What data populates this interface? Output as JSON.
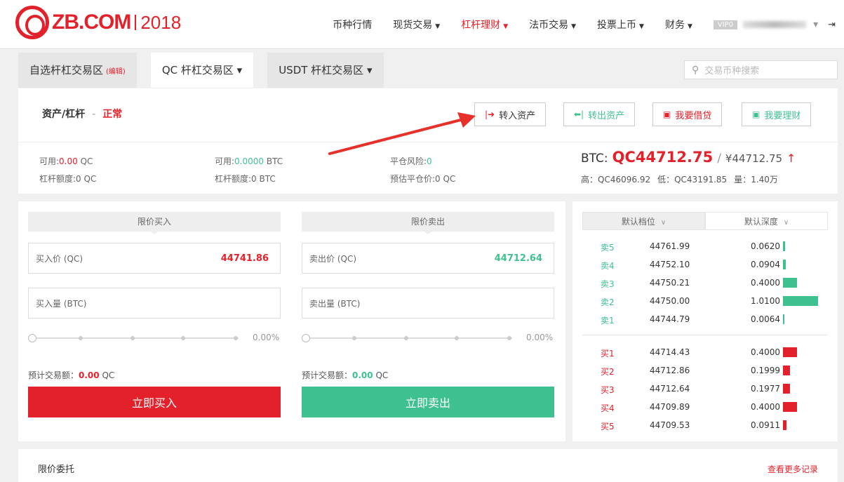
{
  "header": {
    "logo_text": "ZB.COM",
    "logo_year": "2018",
    "nav": [
      {
        "label": "币种行情",
        "caret": false,
        "active": false
      },
      {
        "label": "现货交易",
        "caret": true,
        "active": false
      },
      {
        "label": "杠杆理财",
        "caret": true,
        "active": true
      },
      {
        "label": "法币交易",
        "caret": true,
        "active": false
      },
      {
        "label": "投票上币",
        "caret": true,
        "active": false
      },
      {
        "label": "财务",
        "caret": true,
        "active": false
      }
    ],
    "vip_label": "VIP0",
    "account_caret": "▾",
    "exit_glyph": "⇥"
  },
  "tabs": [
    {
      "label": "自选杆杠交易区",
      "tag": "(编辑)",
      "active": false
    },
    {
      "label": "QC 杆杠交易区",
      "caret": "▾",
      "active": true
    },
    {
      "label": "USDT 杆杠交易区",
      "caret": "▾",
      "active": false
    }
  ],
  "search": {
    "placeholder": "交易币种搜索",
    "icon": "search-icon"
  },
  "assets": {
    "title": "资产/杠杆",
    "separator": "-",
    "status": "正常",
    "buttons": {
      "transfer_in": "转入资产",
      "transfer_out": "转出资产",
      "borrow": "我要借贷",
      "invest": "我要理财"
    },
    "qc_available_label": "可用:",
    "qc_available_value": "0.00",
    "qc_unit": "QC",
    "qc_limit": "杠杆额度:0 QC",
    "btc_available_label": "可用:",
    "btc_available_value": "0.0000",
    "btc_unit": "BTC",
    "btc_limit": "杠杆额度:0 BTC",
    "risk_label": "平仓风险:",
    "risk_value": "0",
    "liq_price": "预估平仓价:0 QC",
    "pair": "BTC:",
    "price_qc": "QC44712.75",
    "slash": "/",
    "price_cny": "¥44712.75",
    "up_arrow": "↑",
    "high": "高：QC46096.92",
    "low": "低：QC43191.85",
    "volume": "量：1.40万"
  },
  "buy": {
    "header": "限价买入",
    "price_label": "买入价 (QC)",
    "price_value": "44741.86",
    "amount_label": "买入量 (BTC)",
    "percent": "0.00%",
    "est_label": "预计交易额：",
    "est_value": "0.00",
    "est_unit": "QC",
    "button": "立即买入"
  },
  "sell": {
    "header": "限价卖出",
    "price_label": "卖出价 (QC)",
    "price_value": "44712.64",
    "amount_label": "卖出量 (BTC)",
    "percent": "0.00%",
    "est_label": "预计交易额：",
    "est_value": "0.00",
    "est_unit": "QC",
    "button": "立即卖出"
  },
  "orderbook": {
    "head_left": "默认档位",
    "head_right": "默认深度",
    "asks": [
      {
        "label": "卖5",
        "price": "44761.99",
        "amount": "0.0620",
        "depth": 0.062
      },
      {
        "label": "卖4",
        "price": "44752.10",
        "amount": "0.0904",
        "depth": 0.0904
      },
      {
        "label": "卖3",
        "price": "44750.21",
        "amount": "0.4000",
        "depth": 0.4
      },
      {
        "label": "卖2",
        "price": "44750.00",
        "amount": "1.0100",
        "depth": 1.01
      },
      {
        "label": "卖1",
        "price": "44744.79",
        "amount": "0.0064",
        "depth": 0.0064
      }
    ],
    "bids": [
      {
        "label": "买1",
        "price": "44714.43",
        "amount": "0.4000",
        "depth": 0.4
      },
      {
        "label": "买2",
        "price": "44712.86",
        "amount": "0.1999",
        "depth": 0.1999
      },
      {
        "label": "买3",
        "price": "44712.64",
        "amount": "0.1977",
        "depth": 0.1977
      },
      {
        "label": "买4",
        "price": "44709.89",
        "amount": "0.4000",
        "depth": 0.4
      },
      {
        "label": "买5",
        "price": "44709.53",
        "amount": "0.0911",
        "depth": 0.0911
      }
    ]
  },
  "orders": {
    "title": "限价委托",
    "more": "查看更多记录"
  },
  "colors": {
    "red": "#e3212a",
    "green": "#3fc18f"
  }
}
